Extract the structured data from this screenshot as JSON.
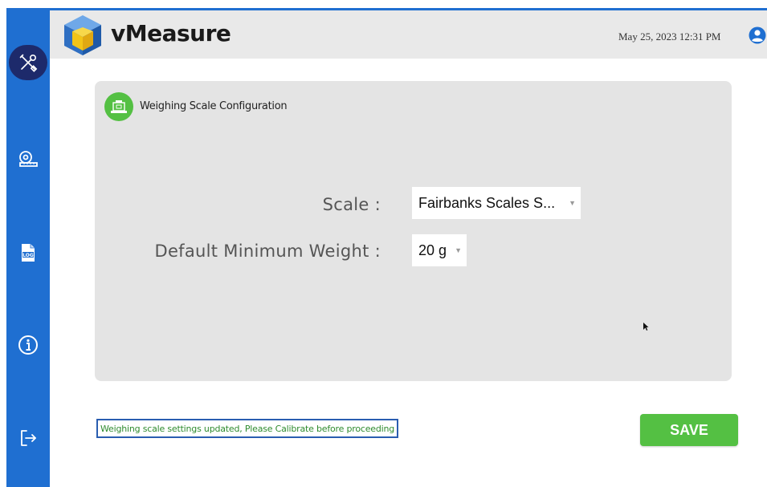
{
  "app": {
    "brand": "vMeasure",
    "datetime": "May 25, 2023 12:31 PM"
  },
  "sidebar": {
    "items": [
      {
        "icon": "tools-icon",
        "active": true
      },
      {
        "icon": "measuring-tape-icon",
        "active": false
      },
      {
        "icon": "log-file-icon",
        "active": false
      },
      {
        "icon": "info-icon",
        "active": false
      },
      {
        "icon": "logout-icon",
        "active": false
      }
    ]
  },
  "config": {
    "title": "Weighing Scale Configuration",
    "scale_label": "Scale :",
    "scale_value": "Fairbanks Scales S...",
    "min_weight_label": "Default Minimum Weight :",
    "min_weight_value": "20 g"
  },
  "status": {
    "message": "Weighing scale settings updated, Please Calibrate before proceeding"
  },
  "actions": {
    "save_label": "SAVE"
  },
  "colors": {
    "sidebar": "#1f6fd1",
    "active_item": "#1d2a6b",
    "accent_green": "#54c043",
    "status_text": "#2e8b2e",
    "status_border": "#2a5db0"
  }
}
